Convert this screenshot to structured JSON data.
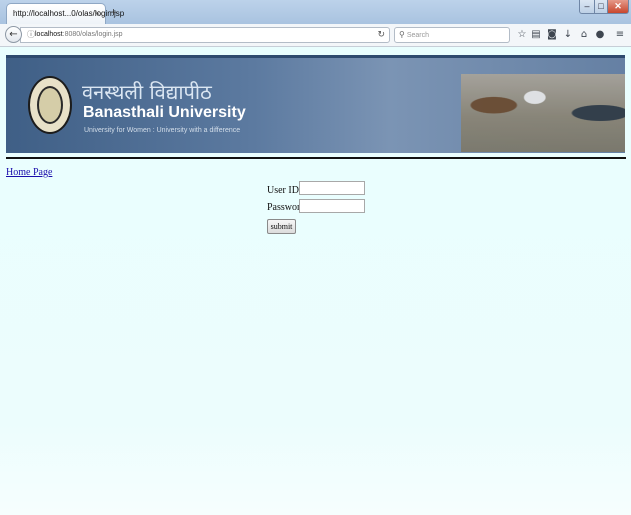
{
  "browser": {
    "tab_title": "http://localhost...0/olas/login.jsp",
    "tab_close": "×",
    "new_tab": "+",
    "url_host": "localhost",
    "url_rest": ":8080/olas/login.jsp",
    "search_placeholder": "Search",
    "window_minimize": "–",
    "window_maximize": "□",
    "window_close": "✕"
  },
  "banner": {
    "hindi_name": "वनस्थली विद्यापीठ",
    "university_name": "Banasthali University",
    "tagline": "University for Women : University with a difference"
  },
  "page": {
    "home_link": "Home Page",
    "user_id_label": "User ID:",
    "user_id_value": "",
    "password_label": "Password:",
    "password_value": "",
    "submit_label": "submit"
  }
}
